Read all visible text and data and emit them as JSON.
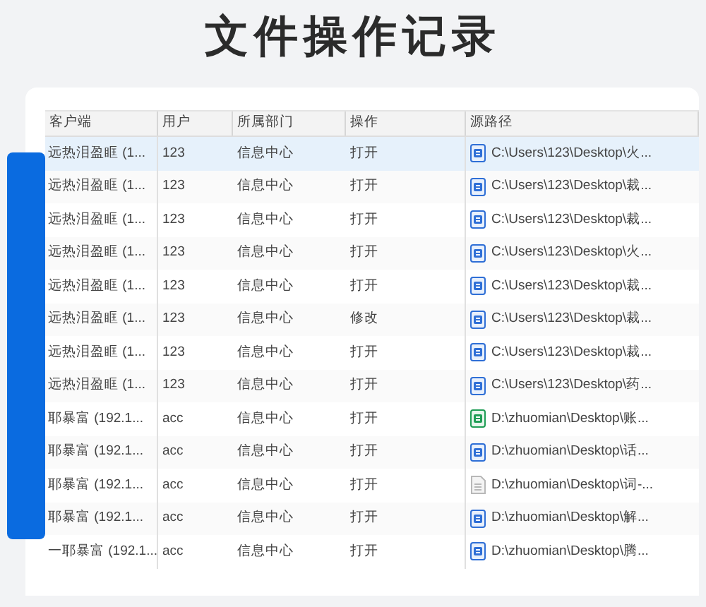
{
  "title": "文件操作记录",
  "table": {
    "columns": [
      "客户端",
      "用户",
      "所属部门",
      "操作",
      "源路径"
    ],
    "rows": [
      {
        "client": "远热泪盈眶 (1...",
        "user": "123",
        "department": "信息中心",
        "action": "打开",
        "kind": "word",
        "path": "C:\\Users\\123\\Desktop\\火...",
        "selected": true
      },
      {
        "client": "远热泪盈眶 (1...",
        "user": "123",
        "department": "信息中心",
        "action": "打开",
        "kind": "word",
        "path": "C:\\Users\\123\\Desktop\\裁...",
        "selected": false
      },
      {
        "client": "远热泪盈眶 (1...",
        "user": "123",
        "department": "信息中心",
        "action": "打开",
        "kind": "word",
        "path": "C:\\Users\\123\\Desktop\\裁...",
        "selected": false
      },
      {
        "client": "远热泪盈眶 (1...",
        "user": "123",
        "department": "信息中心",
        "action": "打开",
        "kind": "word",
        "path": "C:\\Users\\123\\Desktop\\火...",
        "selected": false
      },
      {
        "client": "远热泪盈眶 (1...",
        "user": "123",
        "department": "信息中心",
        "action": "打开",
        "kind": "word",
        "path": "C:\\Users\\123\\Desktop\\裁...",
        "selected": false
      },
      {
        "client": "远热泪盈眶 (1...",
        "user": "123",
        "department": "信息中心",
        "action": "修改",
        "kind": "word",
        "path": "C:\\Users\\123\\Desktop\\裁...",
        "selected": false
      },
      {
        "client": "远热泪盈眶 (1...",
        "user": "123",
        "department": "信息中心",
        "action": "打开",
        "kind": "word",
        "path": "C:\\Users\\123\\Desktop\\裁...",
        "selected": false
      },
      {
        "client": "远热泪盈眶 (1...",
        "user": "123",
        "department": "信息中心",
        "action": "打开",
        "kind": "word",
        "path": "C:\\Users\\123\\Desktop\\药...",
        "selected": false
      },
      {
        "client": "耶暴富 (192.1...",
        "user": "acc",
        "department": "信息中心",
        "action": "打开",
        "kind": "sheet",
        "path": "D:\\zhuomian\\Desktop\\账...",
        "selected": false
      },
      {
        "client": "耶暴富 (192.1...",
        "user": "acc",
        "department": "信息中心",
        "action": "打开",
        "kind": "word",
        "path": "D:\\zhuomian\\Desktop\\话...",
        "selected": false
      },
      {
        "client": "耶暴富 (192.1...",
        "user": "acc",
        "department": "信息中心",
        "action": "打开",
        "kind": "text",
        "path": "D:\\zhuomian\\Desktop\\词-...",
        "selected": false
      },
      {
        "client": "耶暴富 (192.1...",
        "user": "acc",
        "department": "信息中心",
        "action": "打开",
        "kind": "word",
        "path": "D:\\zhuomian\\Desktop\\解...",
        "selected": false
      },
      {
        "client": "一耶暴富 (192.1...",
        "user": "acc",
        "department": "信息中心",
        "action": "打开",
        "kind": "word",
        "path": "D:\\zhuomian\\Desktop\\腾...",
        "selected": false
      }
    ]
  }
}
